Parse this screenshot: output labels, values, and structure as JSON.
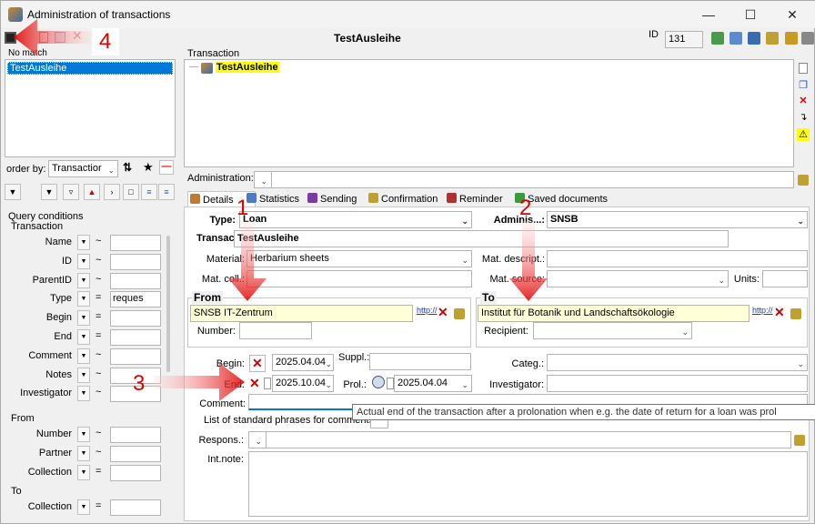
{
  "window": {
    "title": "Administration of transactions",
    "record_title": "TestAusleihe",
    "id_label": "ID",
    "id_value": "131"
  },
  "left": {
    "no_match": "No match",
    "list_items": [
      "TestAusleihe"
    ],
    "order_by_label": "order by:",
    "order_by_value": "Transactior",
    "query_title": "Query conditions",
    "transaction_section": "Transaction",
    "from_section": "From",
    "to_section": "To",
    "transaction_fields": [
      {
        "label": "Name",
        "op": "~",
        "value": ""
      },
      {
        "label": "ID",
        "op": "~",
        "value": ""
      },
      {
        "label": "ParentID",
        "op": "~",
        "value": ""
      },
      {
        "label": "Type",
        "op": "=",
        "value": "reques"
      },
      {
        "label": "Begin",
        "op": "=",
        "value": ""
      },
      {
        "label": "End",
        "op": "=",
        "value": ""
      },
      {
        "label": "Comment",
        "op": "~",
        "value": ""
      },
      {
        "label": "Notes",
        "op": "~",
        "value": ""
      },
      {
        "label": "Investigator",
        "op": "~",
        "value": ""
      }
    ],
    "from_fields": [
      {
        "label": "Number",
        "op": "~",
        "value": ""
      },
      {
        "label": "Partner",
        "op": "~",
        "value": ""
      },
      {
        "label": "Collection",
        "op": "=",
        "value": ""
      }
    ],
    "to_fields": [
      {
        "label": "Collection",
        "op": "=",
        "value": ""
      }
    ]
  },
  "tree": {
    "label": "Transaction",
    "node": "TestAusleihe"
  },
  "administration_label": "Administration:",
  "tabs": [
    "Details",
    "Statistics",
    "Sending",
    "Confirmation",
    "Reminder",
    "Saved documents"
  ],
  "tab_colors": [
    "#c07a30",
    "#4a7ac0",
    "#7a3ca0",
    "#c0a030",
    "#b03030",
    "#3a9a40"
  ],
  "details": {
    "type_label": "Type:",
    "type_value": "Loan",
    "admin_label": "Adminis...:",
    "admin_value": "SNSB",
    "transaction_label": "Transact.:",
    "transaction_value": "TestAusleihe",
    "material_label": "Material:",
    "material_value": "Herbarium sheets",
    "mat_descript_label": "Mat. descript.:",
    "mat_coll_label": "Mat. coll.:",
    "mat_source_label": "Mat. source:",
    "units_label": "Units:",
    "from_title": "From",
    "from_value": "SNSB IT-Zentrum",
    "link_text": "http://",
    "number_label": "Number:",
    "to_title": "To",
    "to_value": "Institut für Botanik und Landschaftsökologie",
    "recipient_label": "Recipient:",
    "begin_label": "Begin:",
    "begin_value": "2025.04.04",
    "suppl_label": "Suppl.:",
    "end_label": "End:",
    "end_value": "2025.10.04",
    "prol_label": "Prol.:",
    "prol_value": "2025.04.04",
    "categ_label": "Categ.:",
    "investigator_label": "Investigator:",
    "comment_label": "Comment:",
    "phrases_label": "List of standard phrases for comments:",
    "respons_label": "Respons.:",
    "intnote_label": "Int.note:",
    "tooltip": "Actual end of the transaction after a prolonation when e.g. the date of return for a loan was prol"
  },
  "annotations": [
    "1",
    "2",
    "3",
    "4"
  ],
  "colors": {
    "arrow": "#e00000",
    "selection": "#0078d7",
    "highlight": "#ffffd8",
    "node_highlight": "#ffff00"
  }
}
